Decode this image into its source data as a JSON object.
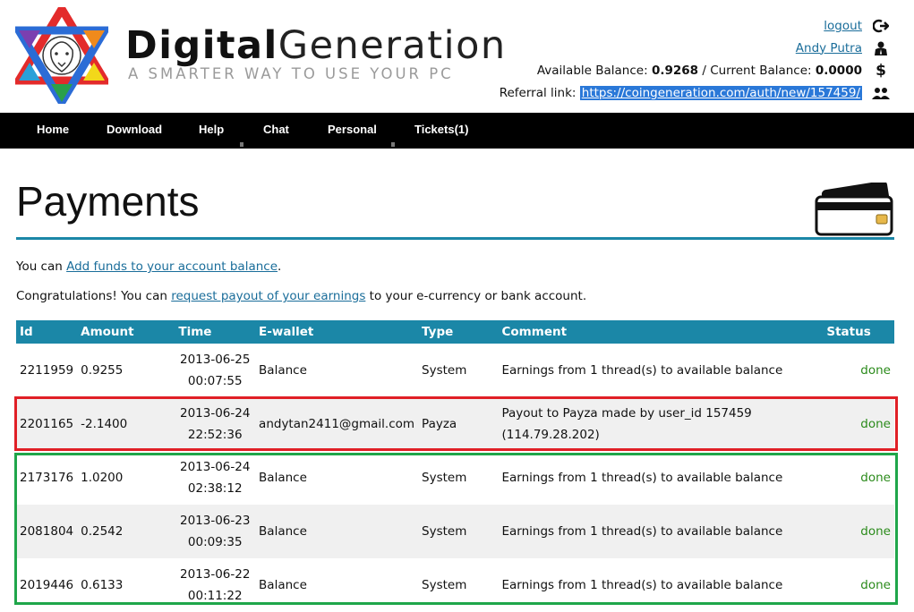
{
  "brand": {
    "bold": "Digital",
    "light": "Generation",
    "tagline": "A SMARTER WAY TO USE YOUR PC"
  },
  "user_panel": {
    "logout": "logout",
    "username": "Andy Putra",
    "available_label": "Available Balance:",
    "available_value": "0.9268",
    "separator": "/",
    "current_label": "Current Balance:",
    "current_value": "0.0000",
    "referral_label": "Referral link:",
    "referral_url": "https://coingeneration.com/auth/new/157459/"
  },
  "nav": [
    "Home",
    "Download",
    "Help",
    "Chat",
    "Personal",
    "Tickets(1)"
  ],
  "page": {
    "title": "Payments",
    "line1_prefix": "You can",
    "line1_link": "Add funds to your account balance",
    "line1_suffix": ".",
    "line2_prefix": "Congratulations! You can",
    "line2_link": "request payout of your earnings",
    "line2_suffix": "to your e-currency or bank account."
  },
  "table": {
    "headers": [
      "Id",
      "Amount",
      "Time",
      "E-wallet",
      "Type",
      "Comment",
      "Status"
    ],
    "rows": [
      {
        "id": "2211959",
        "amount": "0.9255",
        "date": "2013-06-25",
        "time": "00:07:55",
        "ewallet": "Balance",
        "type": "System",
        "comment1": "Earnings from 1 thread(s) to available balance",
        "comment2": "",
        "status": "done"
      },
      {
        "id": "2201165",
        "amount": "-2.1400",
        "date": "2013-06-24",
        "time": "22:52:36",
        "ewallet": "andytan2411@gmail.com",
        "type": "Payza",
        "comment1": "Payout to Payza made by user_id 157459",
        "comment2": "(114.79.28.202)",
        "status": "done"
      },
      {
        "id": "2173176",
        "amount": "1.0200",
        "date": "2013-06-24",
        "time": "02:38:12",
        "ewallet": "Balance",
        "type": "System",
        "comment1": "Earnings from 1 thread(s) to available balance",
        "comment2": "",
        "status": "done"
      },
      {
        "id": "2081804",
        "amount": "0.2542",
        "date": "2013-06-23",
        "time": "00:09:35",
        "ewallet": "Balance",
        "type": "System",
        "comment1": "Earnings from 1 thread(s) to available balance",
        "comment2": "",
        "status": "done"
      },
      {
        "id": "2019446",
        "amount": "0.6133",
        "date": "2013-06-22",
        "time": "00:11:22",
        "ewallet": "Balance",
        "type": "System",
        "comment1": "Earnings from 1 thread(s) to available balance",
        "comment2": "",
        "status": "done"
      }
    ]
  },
  "icons": {
    "logout": "logout-icon",
    "user": "user-icon",
    "balance": "dollar-icon",
    "referral": "users-icon",
    "payment_card": "credit-card-icon"
  },
  "colors": {
    "accent": "#1b87a7",
    "status_done": "#2a8a1a",
    "highlight_red": "#e01f26",
    "highlight_green": "#1fa64a"
  }
}
